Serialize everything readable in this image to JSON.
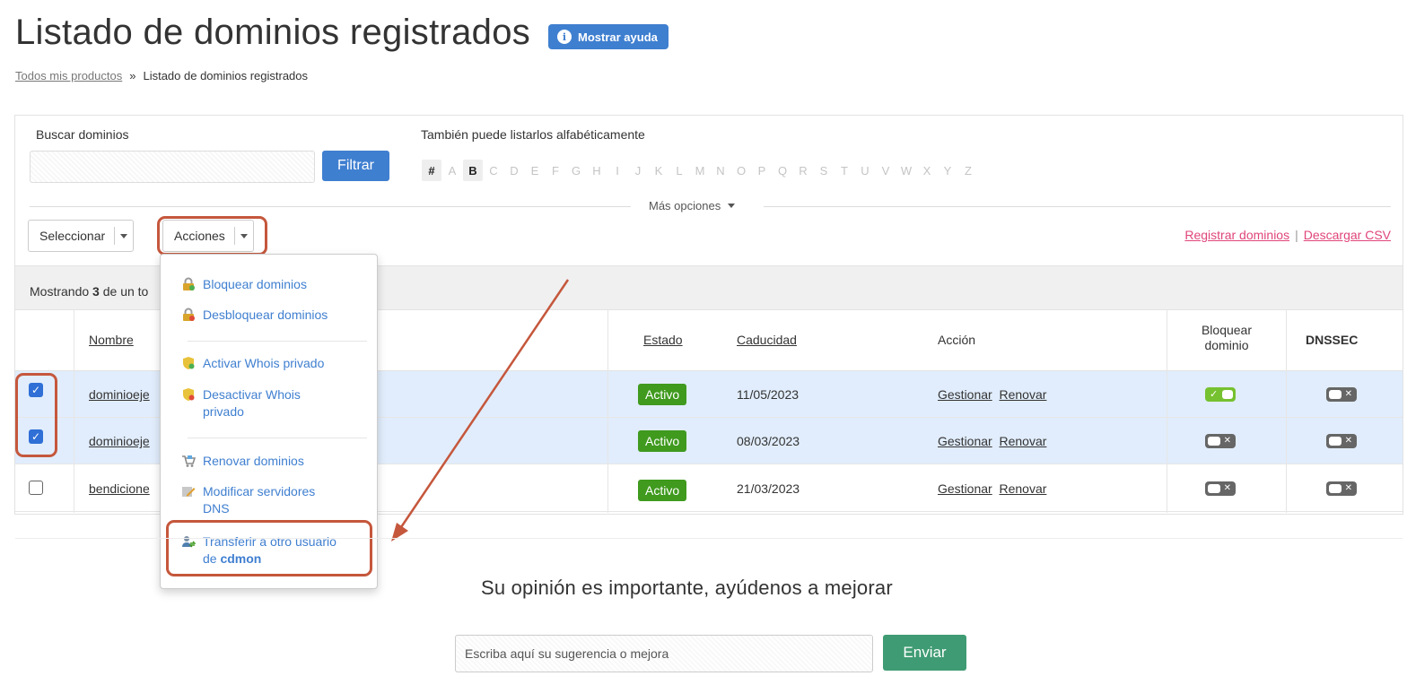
{
  "page": {
    "title": "Listado de dominios registrados",
    "help_label": "Mostrar ayuda"
  },
  "breadcrumb": {
    "home": "Todos mis productos",
    "sep": "»",
    "current": "Listado de dominios registrados"
  },
  "filters": {
    "search_label": "Buscar dominios",
    "search_value": "",
    "filter_button": "Filtrar",
    "alpha_label": "También puede listarlos alfabéticamente",
    "letters": [
      "#",
      "A",
      "B",
      "C",
      "D",
      "E",
      "F",
      "G",
      "H",
      "I",
      "J",
      "K",
      "L",
      "M",
      "N",
      "O",
      "P",
      "Q",
      "R",
      "S",
      "T",
      "U",
      "V",
      "W",
      "X",
      "Y",
      "Z"
    ],
    "active_letters": [
      "#",
      "B"
    ],
    "more_options": "Más opciones"
  },
  "toolbar": {
    "select_label": "Seleccionar",
    "actions_label": "Acciones",
    "register_link": "Registrar dominios",
    "link_sep": "|",
    "csv_link": "Descargar CSV"
  },
  "summary": {
    "prefix": "Mostrando",
    "count": "3",
    "suffix": "de un to"
  },
  "table": {
    "headers": {
      "name": "Nombre",
      "status": "Estado",
      "expiry": "Caducidad",
      "action": "Acción",
      "lock": "Bloquear dominio",
      "dnssec": "DNSSEC"
    },
    "rows": [
      {
        "name": "dominioeje",
        "status": "Activo",
        "expiry": "11/05/2023",
        "manage": "Gestionar",
        "renew": "Renovar",
        "checked": true,
        "lock": true,
        "dnssec": false
      },
      {
        "name": "dominioeje",
        "status": "Activo",
        "expiry": "08/03/2023",
        "manage": "Gestionar",
        "renew": "Renovar",
        "checked": true,
        "lock": false,
        "dnssec": false
      },
      {
        "name": "bendicione",
        "status": "Activo",
        "expiry": "21/03/2023",
        "manage": "Gestionar",
        "renew": "Renovar",
        "checked": false,
        "lock": false,
        "dnssec": false
      }
    ]
  },
  "actions_menu": {
    "lock": "Bloquear dominios",
    "unlock": "Desbloquear dominios",
    "whois_on": "Activar Whois privado",
    "whois_off_1": "Desactivar Whois",
    "whois_off_2": "privado",
    "renew": "Renovar dominios",
    "dns_1": "Modificar servidores",
    "dns_2": "DNS",
    "transfer_1": "Transferir a otro usuario",
    "transfer_2_prefix": "de",
    "transfer_2_brand": "cdmon"
  },
  "feedback": {
    "title": "Su opinión es importante, ayúdenos a mejorar",
    "placeholder": "Escriba aquí su sugerencia o mejora",
    "send": "Enviar"
  },
  "colors": {
    "primary": "#3f7fd0",
    "active_badge": "#3f9a1e",
    "pink_link": "#e0457b",
    "annotation": "#c5573c",
    "send": "#3f9b73"
  }
}
